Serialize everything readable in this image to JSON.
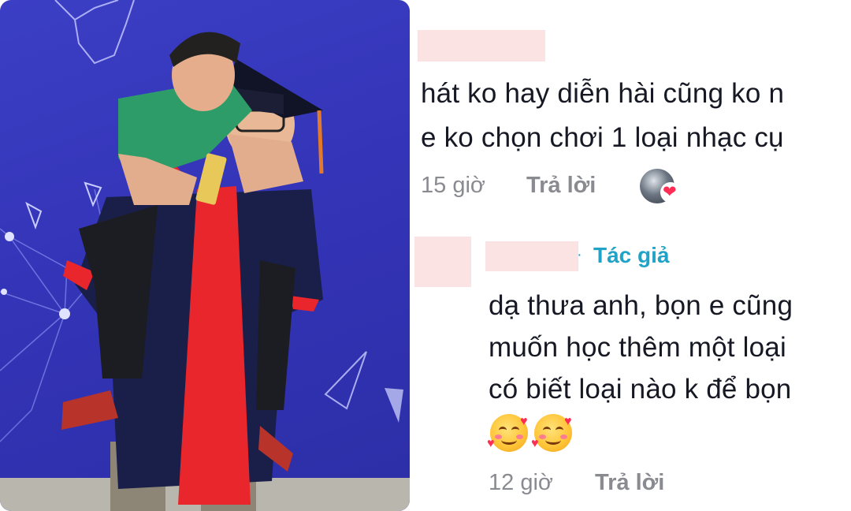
{
  "colors": {
    "photo_backdrop": "#3434b8",
    "gown": "#1a1f4a",
    "gown_stripe": "#e8262b",
    "shirt": "#2e9c68",
    "redaction": "#fbe3e3",
    "author_tag": "#21a3c8",
    "meta_text": "#8a8b91",
    "body_text": "#161823",
    "heart": "#ff2d55"
  },
  "photo": {
    "icons": [
      "network-lines",
      "triangle-outline",
      "world-map-outline"
    ]
  },
  "comment_1": {
    "line_1": "hát ko hay diễn hài cũng ko n",
    "line_2": "e ko chọn chơi 1 loại nhạc cụ",
    "time": "15 giờ",
    "reply_label": "Trả lời",
    "liked_by_icon": "avatar-with-heart-icon"
  },
  "comment_2": {
    "author_tag": "Tác giả",
    "separator": "·",
    "line_1": "dạ thưa anh, bọn e cũng",
    "line_2": "muốn học thêm một loại",
    "line_3": "có biết loại nào k để bọn",
    "emoji_icons": [
      "smiling-face-with-hearts-icon",
      "smiling-face-with-hearts-icon"
    ],
    "time": "12 giờ",
    "reply_label": "Trả lời"
  }
}
